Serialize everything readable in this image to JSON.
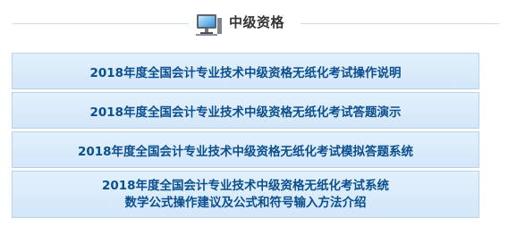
{
  "header": {
    "title": "中级资格",
    "icon": "computer-monitor-icon"
  },
  "links": [
    {
      "lines": [
        "2018年度全国会计专业技术中级资格无纸化考试操作说明"
      ]
    },
    {
      "lines": [
        "2018年度全国会计专业技术中级资格无纸化考试答题演示"
      ]
    },
    {
      "lines": [
        "2018年度全国会计专业技术中级资格无纸化考试模拟答题系统"
      ]
    },
    {
      "lines": [
        "2018年度全国会计专业技术中级资格无纸化考试系统",
        "数学公式操作建议及公式和符号输入方法介绍"
      ]
    }
  ],
  "colors": {
    "link_text": "#0b4f8f",
    "link_background": "#d9ebfb",
    "link_border": "#b9d3ec",
    "header_title": "#333333"
  }
}
